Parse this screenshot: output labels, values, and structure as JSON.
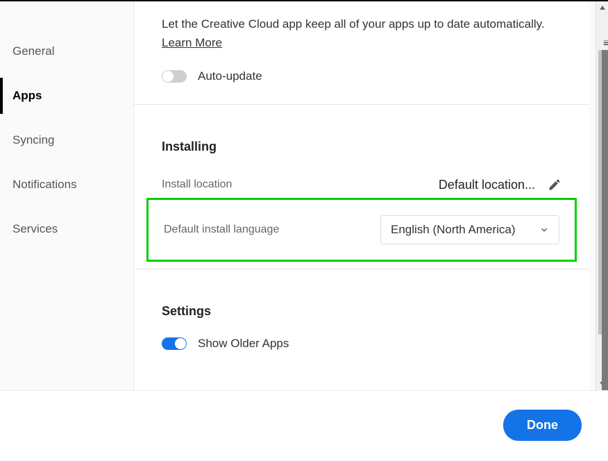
{
  "sidebar": {
    "items": [
      {
        "label": "General"
      },
      {
        "label": "Apps"
      },
      {
        "label": "Syncing"
      },
      {
        "label": "Notifications"
      },
      {
        "label": "Services"
      }
    ],
    "active_index": 1
  },
  "updates": {
    "description": "Let the Creative Cloud app keep all of your apps up to date automatically.",
    "learn_more": "Learn More",
    "auto_update_label": "Auto-update",
    "auto_update_on": false
  },
  "installing": {
    "title": "Installing",
    "location_label": "Install location",
    "location_value": "Default location...",
    "language_label": "Default install language",
    "language_value": "English (North America)"
  },
  "settings": {
    "title": "Settings",
    "show_older_label": "Show Older Apps",
    "show_older_on": true
  },
  "footer": {
    "done_label": "Done"
  }
}
